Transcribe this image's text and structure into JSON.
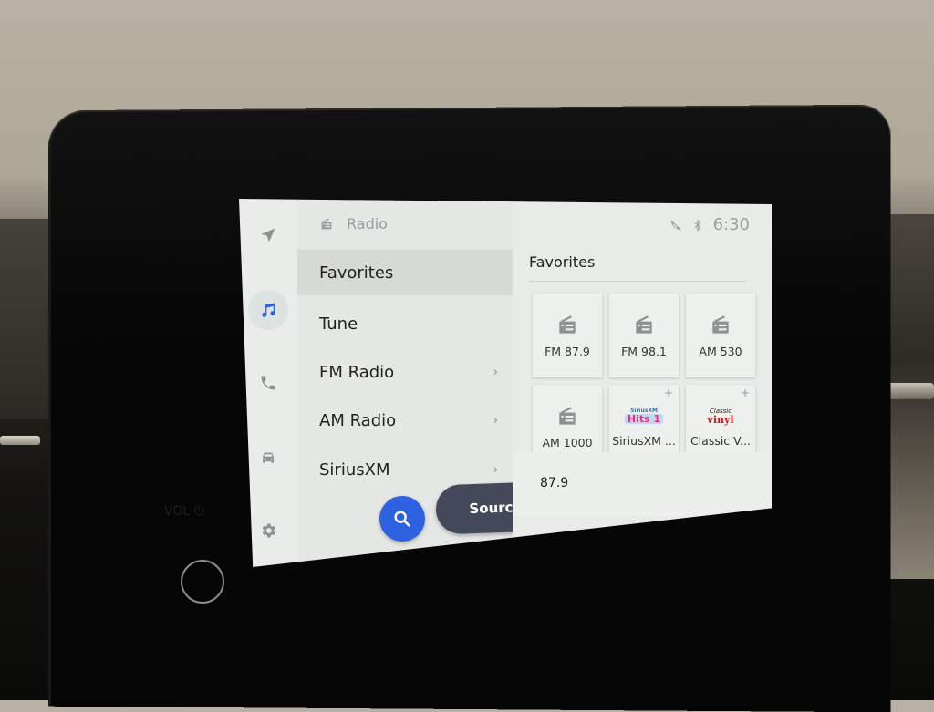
{
  "rail": {
    "items": [
      {
        "name": "navigation",
        "icon": "navigation-arrow-icon",
        "active": false
      },
      {
        "name": "music",
        "icon": "music-note-icon",
        "active": true
      },
      {
        "name": "phone",
        "icon": "phone-icon",
        "active": false
      },
      {
        "name": "vehicle",
        "icon": "car-icon",
        "active": false
      },
      {
        "name": "settings",
        "icon": "gear-icon",
        "active": false
      }
    ]
  },
  "menu": {
    "header": {
      "icon": "radio-icon",
      "label": "Radio"
    },
    "items": [
      {
        "label": "Favorites",
        "active": true,
        "has_chevron": false
      },
      {
        "label": "Tune",
        "active": false,
        "has_chevron": false
      },
      {
        "label": "FM Radio",
        "active": false,
        "has_chevron": true
      },
      {
        "label": "AM Radio",
        "active": false,
        "has_chevron": true
      },
      {
        "label": "SiriusXM",
        "active": false,
        "has_chevron": true
      }
    ],
    "search_icon": "search-icon",
    "sources_label": "Sources",
    "chevron_glyph": "›"
  },
  "status": {
    "icons": [
      "no-phone-icon",
      "bluetooth-icon"
    ],
    "time": "6:30"
  },
  "content": {
    "title": "Favorites",
    "tiles": [
      {
        "label": "FM 87.9",
        "type": "radio"
      },
      {
        "label": "FM 98.1",
        "type": "radio"
      },
      {
        "label": "AM 530",
        "type": "radio"
      },
      {
        "label": "AM 1000",
        "type": "radio"
      },
      {
        "label": "SiriusXM ...",
        "type": "logo",
        "logo_top": "SiriusXM",
        "logo_main": "Hits 1",
        "plus": "+"
      },
      {
        "label": "Classic V...",
        "type": "logo",
        "logo_top": "Classic",
        "logo_main": "vinyl",
        "plus": "+"
      }
    ],
    "now_playing": "87.9"
  },
  "hardware": {
    "vol_label": "VOL ⏻"
  },
  "colors": {
    "accent": "#2f62e0",
    "sources_button": "#45485a",
    "active_icon": "#2f62e0",
    "inactive_icon": "#8e9190"
  }
}
